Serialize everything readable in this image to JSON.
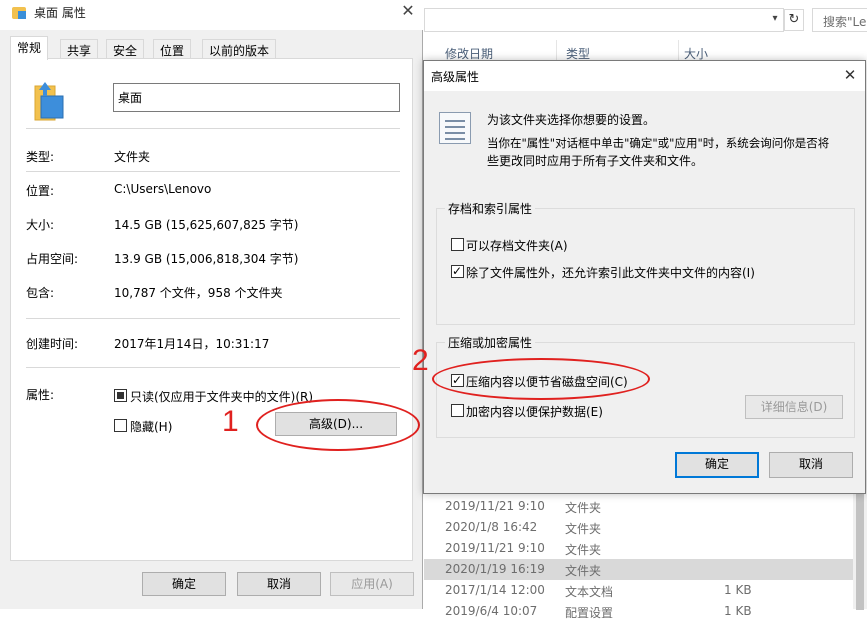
{
  "explorer": {
    "search_placeholder": "搜索\"Lenovo\"",
    "columns": [
      "修改日期",
      "类型",
      "大小"
    ],
    "rows": [
      {
        "date": "2019/11/21 9:10",
        "type": "文件夹",
        "size": "",
        "selected": false
      },
      {
        "date": "2020/1/8 16:42",
        "type": "文件夹",
        "size": "",
        "selected": false
      },
      {
        "date": "2019/11/21 9:10",
        "type": "文件夹",
        "size": "",
        "selected": false
      },
      {
        "date": "2020/1/19 16:19",
        "type": "文件夹",
        "size": "",
        "selected": true
      },
      {
        "date": "2017/1/14 12:00",
        "type": "文本文档",
        "size": "1 KB",
        "selected": false
      },
      {
        "date": "2019/6/4 10:07",
        "type": "配置设置",
        "size": "1 KB",
        "selected": false
      }
    ]
  },
  "props": {
    "title": "桌面 属性",
    "tabs": [
      "常规",
      "共享",
      "安全",
      "位置",
      "以前的版本"
    ],
    "name": "桌面",
    "type_label": "类型:",
    "type_value": "文件夹",
    "location_label": "位置:",
    "location_value": "C:\\Users\\Lenovo",
    "size_label": "大小:",
    "size_value": "14.5 GB (15,625,607,825 字节)",
    "disk_label": "占用空间:",
    "disk_value": "13.9 GB (15,006,818,304 字节)",
    "contains_label": "包含:",
    "contains_value": "10,787 个文件，958 个文件夹",
    "created_label": "创建时间:",
    "created_value": "2017年1月14日，10:31:17",
    "attributes_label": "属性:",
    "readonly_label": "只读(仅应用于文件夹中的文件)(R)",
    "hidden_label": "隐藏(H)",
    "advanced_button": "高级(D)...",
    "ok": "确定",
    "cancel": "取消",
    "apply": "应用(A)"
  },
  "annotations": {
    "first": "1",
    "second": "2",
    "color": "#e0211f"
  },
  "advanced": {
    "title": "高级属性",
    "intro_line1": "为该文件夹选择你想要的设置。",
    "intro_line2": "当你在\"属性\"对话框中单击\"确定\"或\"应用\"时，系统会询问你是否将",
    "intro_line3": "些更改同时应用于所有子文件夹和文件。",
    "archive_group_title": "存档和索引属性",
    "archive_label": "可以存档文件夹(A)",
    "archive_checked": false,
    "index_label": "除了文件属性外，还允许索引此文件夹中文件的内容(I)",
    "index_checked": true,
    "compress_group_title": "压缩或加密属性",
    "compress_label": "压缩内容以便节省磁盘空间(C)",
    "compress_checked": true,
    "encrypt_label": "加密内容以便保护数据(E)",
    "encrypt_checked": false,
    "details_button": "详细信息(D)",
    "ok": "确定",
    "cancel": "取消"
  }
}
